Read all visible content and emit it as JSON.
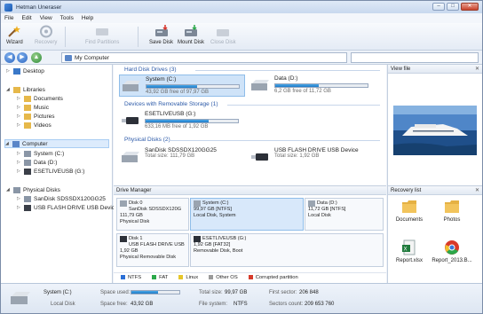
{
  "window": {
    "title": "Hetman Uneraser"
  },
  "menu": [
    "File",
    "Edit",
    "View",
    "Tools",
    "Help"
  ],
  "toolbar": {
    "wizard": "Wizard",
    "recovery": "Recovery",
    "find_partitions": "Find Partitions",
    "save_disk": "Save Disk",
    "mount_disk": "Mount Disk",
    "close_disk": "Close Disk"
  },
  "address": {
    "path": "My Computer"
  },
  "sidebar": {
    "desktop": "Desktop",
    "libraries": "Libraries",
    "documents": "Documents",
    "music": "Music",
    "pictures": "Pictures",
    "videos": "Videos",
    "computer": "Computer",
    "system": "System (C:)",
    "data": "Data (D:)",
    "eset": "ESETLIVEUSB (G:)",
    "physical": "Physical Disks",
    "sandisk": "SanDisk SDSSDX120GG25",
    "usb": "USB FLASH DRIVE USB Device"
  },
  "sections": {
    "hdd": "Hard Disk Drives (3)",
    "removable": "Devices with Removable Storage (1)",
    "physical": "Physical Disks (2)"
  },
  "drives": {
    "system": {
      "name": "System (C:)",
      "free": "43,92 GB free of 97,97 GB",
      "used_fraction": 0.55
    },
    "data": {
      "name": "Data (D:)",
      "free": "6,2 GB free of 11,72 GB",
      "used_fraction": 0.47
    },
    "eset": {
      "name": "ESETLIVEUSB (G:)",
      "free": "633,16 MB free of 1,92 GB",
      "used_fraction": 0.68
    },
    "sandisk": {
      "name": "SanDisk SDSSDX120GG25",
      "size": "Total size: 111,79 GB"
    },
    "usbflash": {
      "name": "USB FLASH DRIVE USB Device",
      "size": "Total size: 1,92 GB"
    }
  },
  "viewfile": {
    "title": "View file"
  },
  "drive_manager": {
    "title": "Drive Manager",
    "disk0": {
      "name": "Disk 0",
      "model": "SanDisk SDSSDX120G",
      "size": "111,79 GB",
      "type": "Physical Disk"
    },
    "p_system": {
      "name": "System (C:)",
      "size": "99,97 GB [NTFS]",
      "flags": "Local Disk, System"
    },
    "p_data": {
      "name": "Data (D:)",
      "size": "11,72 GB [NTFS]",
      "flags": "Local Disk"
    },
    "disk1": {
      "name": "Disk 1",
      "model": "USB FLASH DRIVE USB",
      "size": "1,92 GB",
      "type": "Physical Removable Disk"
    },
    "p_eset": {
      "name": "ESETLIVEUSB (G:)",
      "size": "1,92 GB [FAT32]",
      "flags": "Removable Disk, Boot"
    },
    "legend": [
      "NTFS",
      "FAT",
      "Linux",
      "Other OS",
      "Corrupted partition"
    ]
  },
  "recovery_list": {
    "title": "Recovery list",
    "items": [
      "Documents",
      "Photos",
      "Report.xlsx",
      "Report_2013.B..."
    ]
  },
  "status": {
    "name": "System (C:)",
    "type": "Local Disk",
    "space_used_label": "Space used:",
    "space_free_label": "Space free:",
    "space_free": "43,92 GB",
    "total_label": "Total size:",
    "total": "99,97 GB",
    "fs_label": "File system:",
    "fs": "NTFS",
    "first_sector_label": "First sector:",
    "first_sector": "206 848",
    "sectors_count_label": "Sectors count:",
    "sectors_count": "209 653 760",
    "used_fraction": 0.56
  },
  "colors": {
    "accent": "#2b59a8",
    "bar": "#1e7ac6",
    "ntfs": "#2b6fd6",
    "fat": "#2ba84a",
    "linux": "#e6c62a",
    "other": "#9a9a9a",
    "corrupted": "#d63a2a"
  }
}
